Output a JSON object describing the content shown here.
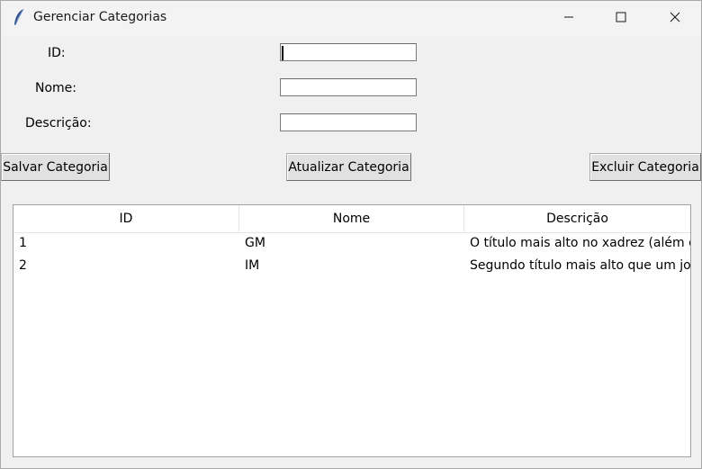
{
  "window": {
    "title": "Gerenciar Categorias",
    "icon": "feather-icon",
    "controls": [
      "minimize-icon",
      "maximize-icon",
      "close-icon"
    ]
  },
  "form": {
    "id_label": "ID:",
    "id_value": "",
    "nome_label": "Nome:",
    "nome_value": "",
    "descricao_label": "Descrição:",
    "descricao_value": ""
  },
  "buttons": {
    "save": "Salvar Categoria",
    "update": "Atualizar Categoria",
    "delete": "Excluir Categoria"
  },
  "table": {
    "columns": [
      "ID",
      "Nome",
      "Descrição"
    ],
    "rows": [
      [
        "1",
        "GM",
        "O título mais alto no xadrez (além do"
      ],
      [
        "2",
        "IM",
        "Segundo título mais alto que um jogador"
      ]
    ]
  }
}
